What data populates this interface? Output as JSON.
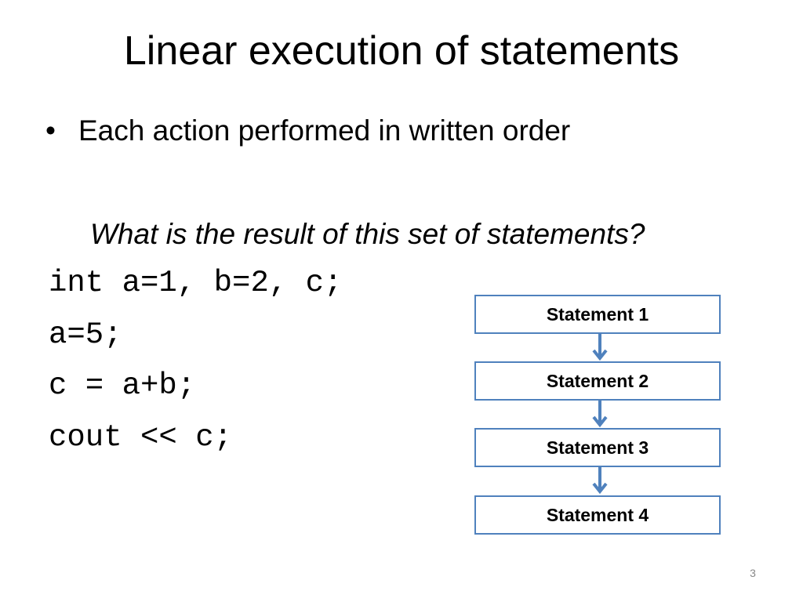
{
  "slide": {
    "title": "Linear execution of statements",
    "bullet": "Each action performed in written order",
    "bullet_symbol": "•",
    "question": "What is the result of this set of statements?",
    "code_lines": [
      "int a=1, b=2, c;",
      "a=5;",
      "c = a+b;",
      "cout << c;"
    ],
    "flowchart": {
      "boxes": [
        "Statement 1",
        "Statement 2",
        "Statement 3",
        "Statement 4"
      ],
      "border_color": "#4f81bd",
      "arrow_color": "#4f81bd"
    },
    "page_number": "3"
  }
}
